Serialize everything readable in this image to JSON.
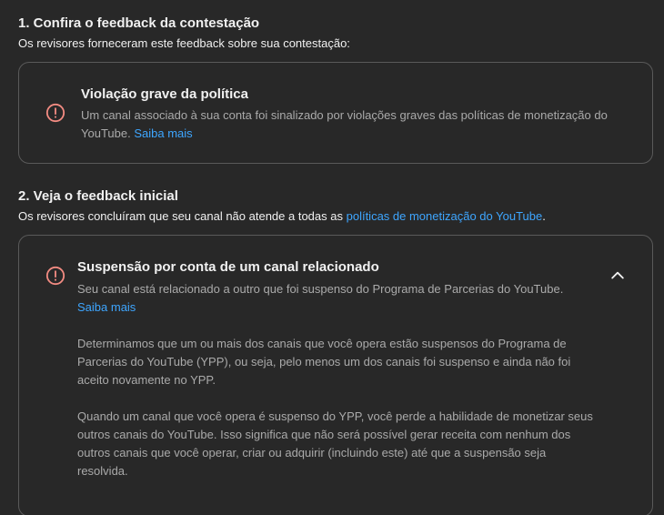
{
  "section1": {
    "title": "1. Confira o feedback da contestação",
    "subtitle": "Os revisores forneceram este feedback sobre sua contestação:",
    "card": {
      "icon": "alert-circle-icon",
      "title": "Violação grave da política",
      "body_line1": "Um canal associado à sua conta foi sinalizado por violações graves das políticas de monetização do",
      "body_line2": "YouTube.",
      "link": "Saiba mais"
    }
  },
  "section2": {
    "title": "2. Veja o feedback inicial",
    "subtitle_prefix": "Os revisores concluíram que seu canal não atende a todas as ",
    "subtitle_link": "políticas de monetização do YouTube",
    "subtitle_suffix": ".",
    "card": {
      "icon": "alert-circle-icon",
      "title": "Suspensão por conta de um canal relacionado",
      "body": "Seu canal está relacionado a outro que foi suspenso do Programa de Parcerias do YouTube.",
      "link": "Saiba mais",
      "toggle_icon": "chevron-up-icon",
      "paragraph1_line1": "Determinamos que um ou mais dos canais que você opera estão suspensos do Programa de",
      "paragraph1_line2": "Parcerias do YouTube (YPP), ou seja, pelo menos um dos canais foi suspenso e ainda não foi",
      "paragraph1_line3": "aceito novamente no YPP.",
      "paragraph2_line1": "Quando um canal que você opera é suspenso do YPP, você perde a habilidade de monetizar seus",
      "paragraph2_line2": "outros canais do YouTube. Isso significa que não será possível gerar receita com nenhum dos",
      "paragraph2_line3": "outros canais que você operar, criar ou adquirir (incluindo este) até que a suspensão seja",
      "paragraph2_line4": "resolvida."
    }
  },
  "colors": {
    "background": "#282828",
    "border": "#5a5a5a",
    "link": "#3ea6ff",
    "alert": "#f28b82",
    "muted_text": "#aaaaaa"
  }
}
